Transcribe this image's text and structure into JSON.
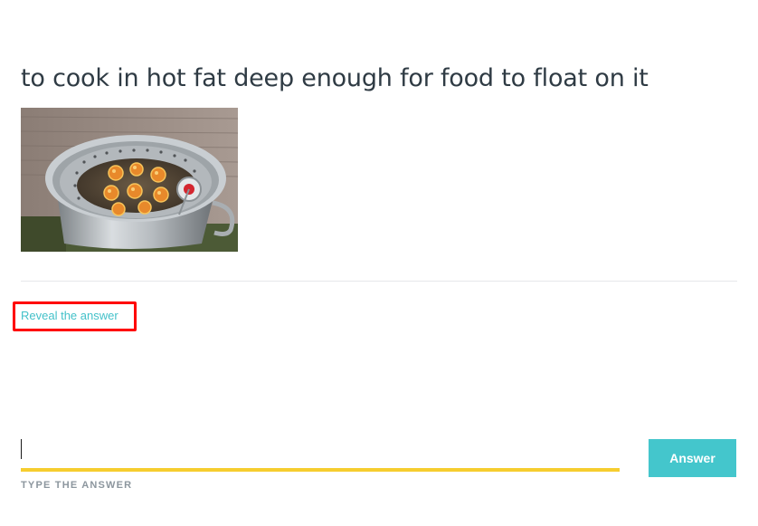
{
  "question": {
    "prompt": "to cook in hot fat deep enough for food to float on it"
  },
  "image": {
    "alt": "deep fryer with food frying in oil"
  },
  "reveal": {
    "label": "Reveal the answer"
  },
  "answer_form": {
    "input_value": "",
    "input_label": "TYPE THE ANSWER",
    "button_label": "Answer"
  },
  "colors": {
    "accent": "#44c6cc",
    "underline": "#f6cd2f",
    "highlight_box": "#ff0000",
    "text": "#2f3b44"
  }
}
